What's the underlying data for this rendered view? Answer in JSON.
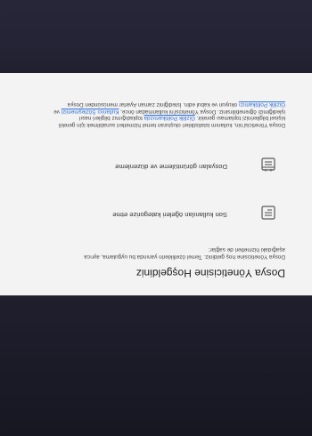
{
  "screen": {
    "title": "Dosya Yöneticisine Hoşgeldiniz",
    "intro": "Dosya Yöneticisine hoş geldiniz. Temel özelliklerin yanında bu uygulama, ayrıca aşağıdaki hizmetleri de sağlar:",
    "features": [
      {
        "icon": "list-icon",
        "label": "Son kullanılan öğeleri kategorize etme"
      },
      {
        "icon": "document-list-icon",
        "label": "Dosyaları görüntüleme ve düzenleme"
      }
    ],
    "legal": {
      "part1": "Dosya Yöneticisi'nin, kullanım istatistikleri oluşturan temel hizmetleri sunabilmek için gerekli kişisel bilgilerinizi toplaması gerekir. ",
      "link1": "Gizlilik Politikamızda",
      "part2": " topladığımız bilgileri nasıl işlediğimizi öğrenebilirsiniz. Dosya Yöneticisi'ni kullanmadan önce, ",
      "link2": "Kullanıcı Sözleşmemizi",
      "part3": " ve ",
      "link3": "Gizlilik Politikamızı",
      "part4": " okuyun ve kabul edin. İstediğiniz zaman Ayarlar menüsünden Dosya"
    },
    "accent_color": "#f0a64a",
    "link_color": "#2f6fd6"
  }
}
